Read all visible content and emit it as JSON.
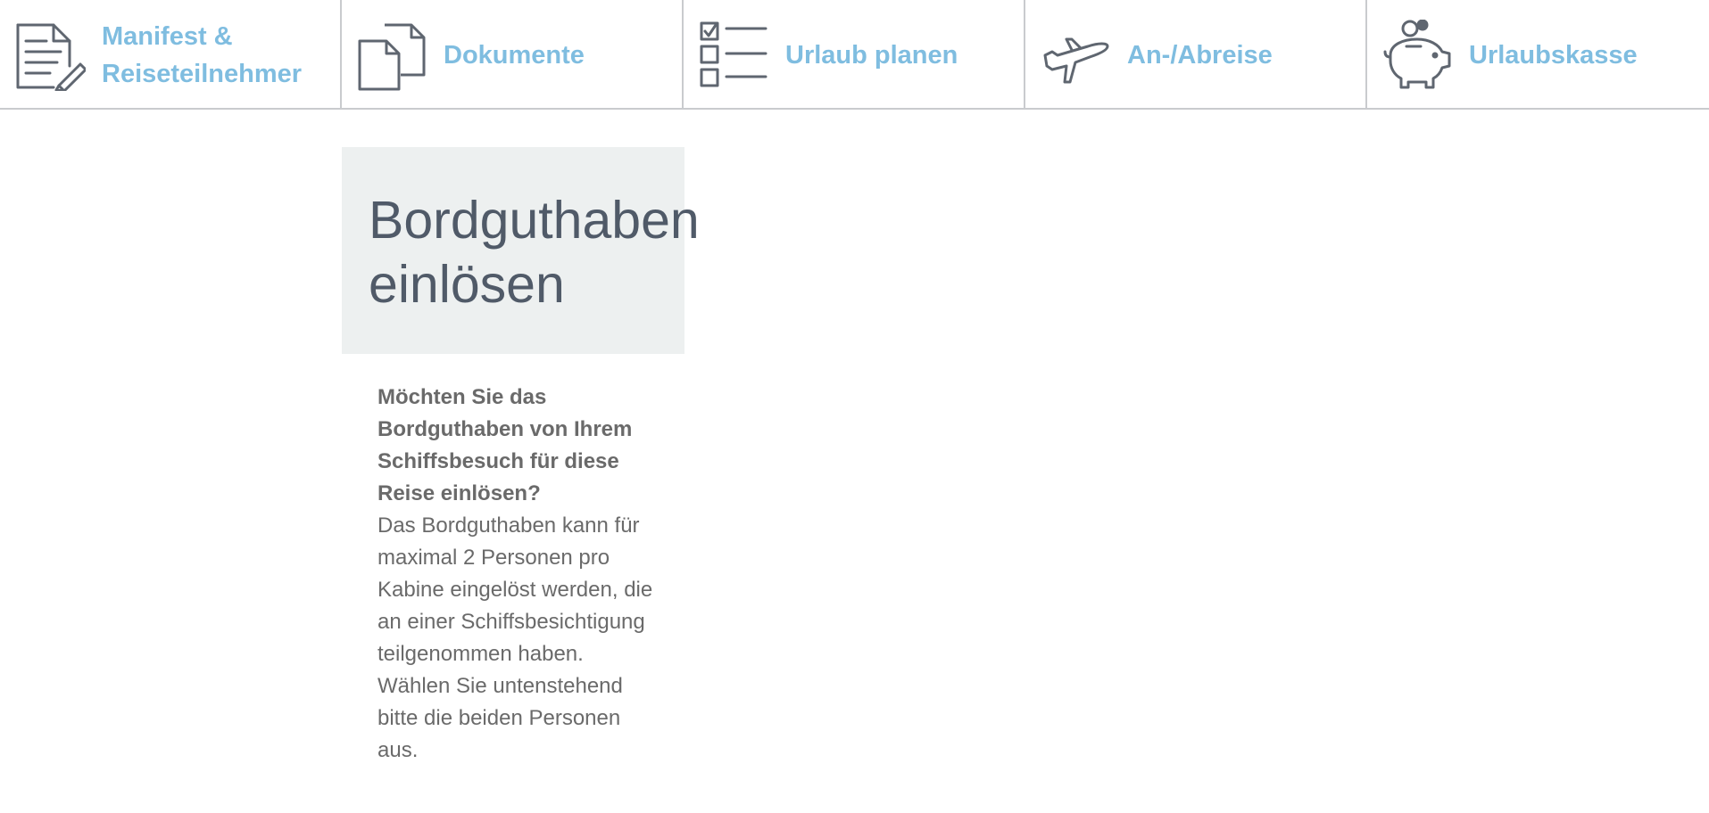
{
  "nav": {
    "items": [
      {
        "label": "Manifest &\nReiseteilnehmer",
        "icon": "document-edit-icon"
      },
      {
        "label": "Dokumente",
        "icon": "documents-icon"
      },
      {
        "label": "Urlaub planen",
        "icon": "checklist-icon"
      },
      {
        "label": "An-/Abreise",
        "icon": "airplane-icon"
      },
      {
        "label": "Urlaubskasse",
        "icon": "piggy-bank-icon"
      }
    ]
  },
  "hero": {
    "title": "Bordguthaben einlösen"
  },
  "content": {
    "lead": "Möchten Sie das Bordguthaben von Ihrem Schiffsbesuch für diese Reise einlösen?",
    "body": "Das Bordguthaben kann für maximal 2 Personen pro Kabine eingelöst werden, die an einer Schiffsbesichtigung teilgenommen haben. Wählen Sie untenstehend bitte die beiden Personen aus."
  },
  "colors": {
    "accent": "#7fbde0",
    "title": "#505a68",
    "text": "#6a6a6a",
    "hero_bg": "#edf0f0",
    "divider": "#c9cbce",
    "icon": "#5f6670"
  }
}
